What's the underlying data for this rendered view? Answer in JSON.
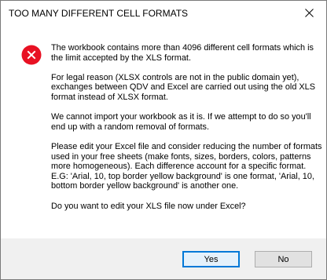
{
  "dialog": {
    "title": "TOO MANY DIFFERENT CELL FORMATS",
    "close_icon": "close-icon",
    "icon": "error-icon",
    "colors": {
      "error_red": "#e81123",
      "accent": "#0078d7",
      "footer_bg": "#f0f0f0"
    },
    "paragraphs": [
      "The workbook contains more than 4096 different cell formats which is the limit accepted by the XLS format.",
      "For legal reason (XLSX controls are not in the public domain yet), exchanges between QDV and Excel are carried out using the old XLS format instead of XLSX format.",
      "We cannot import your workbook as it is. If we attempt to do so you'll end up with a random removal of formats.",
      "Please edit your Excel file and consider reducing the number of formats used in your free sheets (make fonts, sizes, borders, colors, patterns more homogeneous). Each difference account for a specific format. E.G: 'Arial, 10, top border yellow background' is one format, 'Arial, 10, bottom border yellow background' is another one.",
      "Do you want to edit your XLS file now under Excel?"
    ],
    "buttons": {
      "yes_label": "Yes",
      "no_label": "No"
    }
  }
}
